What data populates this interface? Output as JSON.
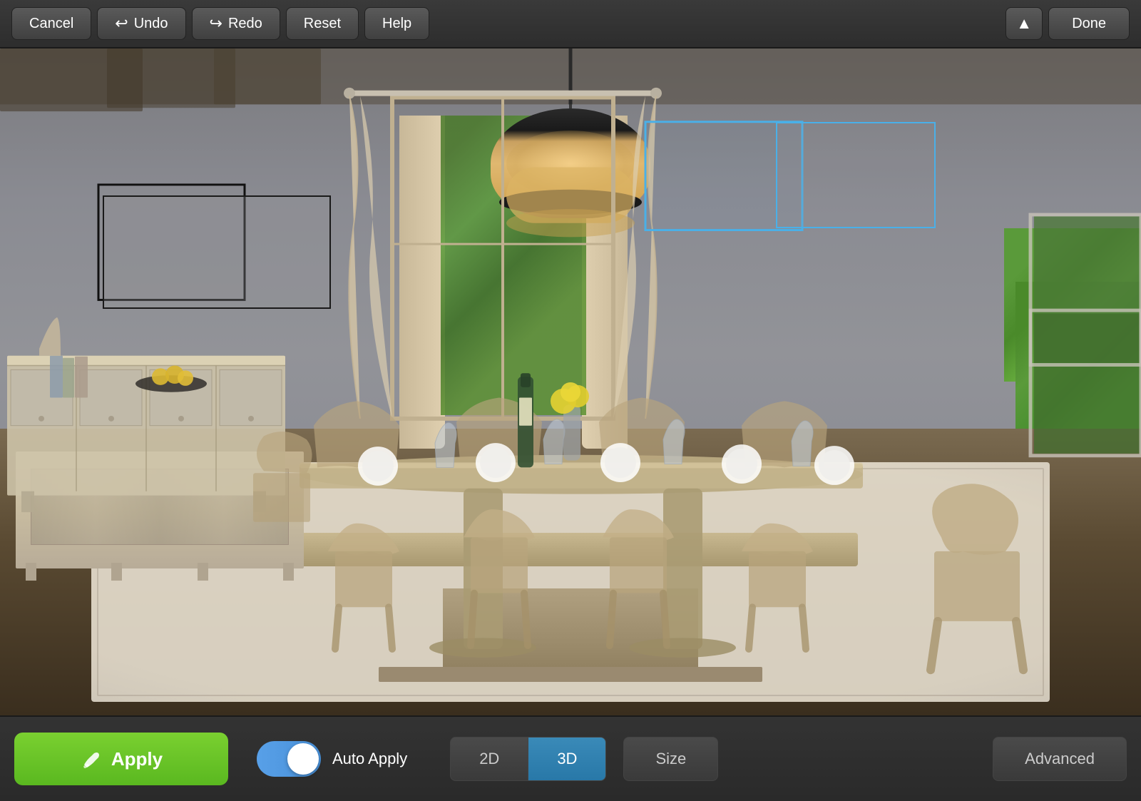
{
  "toolbar": {
    "cancel_label": "Cancel",
    "undo_label": "Undo",
    "redo_label": "Redo",
    "reset_label": "Reset",
    "help_label": "Help",
    "done_label": "Done",
    "chevron_label": "▲"
  },
  "bottom": {
    "apply_label": "Apply",
    "auto_apply_label": "Auto Apply",
    "mode_2d_label": "2D",
    "mode_3d_label": "3D",
    "size_label": "Size",
    "advanced_label": "Advanced"
  },
  "scene": {
    "selection_box_black": "wall art selection",
    "selection_box_blue": "window selection"
  }
}
